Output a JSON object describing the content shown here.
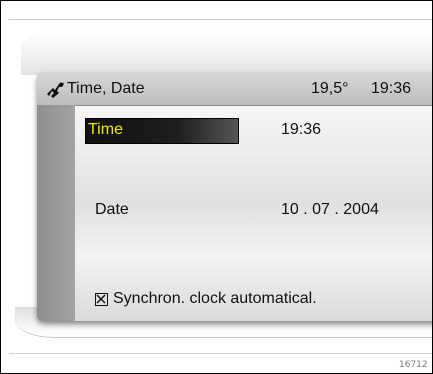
{
  "header": {
    "icon": "clock-settings-icon",
    "title": "Time, Date",
    "temperature": "19,5°",
    "clock": "19:36"
  },
  "settings": {
    "time": {
      "label": "Time",
      "value": "19:36"
    },
    "date": {
      "label": "Date",
      "value": "10 . 07 . 2004"
    },
    "sync": {
      "label": "Synchron. clock automatical.",
      "checked": true
    }
  },
  "colors": {
    "highlight_bg": "#111111",
    "highlight_text": "#f2e400"
  },
  "footer": {
    "ref_code": "16712"
  }
}
